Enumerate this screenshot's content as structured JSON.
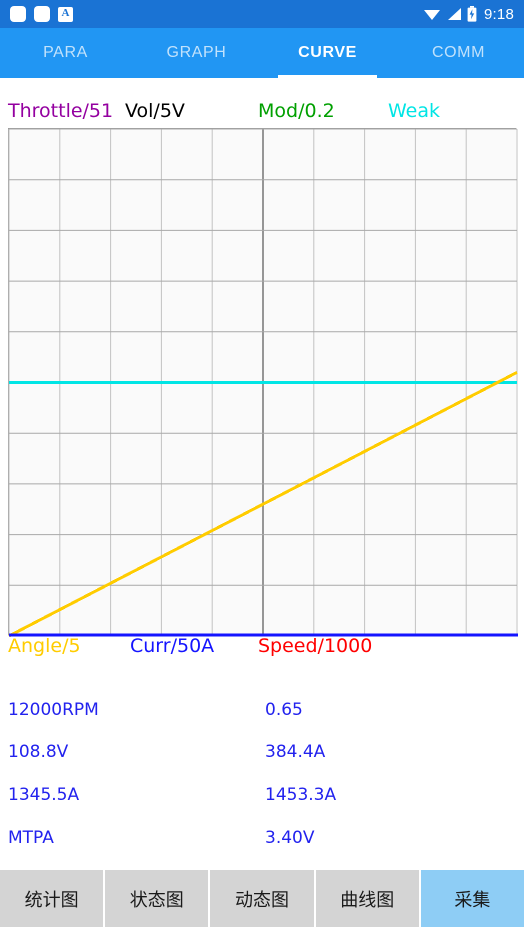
{
  "statusbar": {
    "icons": [
      "square-icon",
      "square-icon",
      "keyboard-ime-icon",
      "wifi-icon",
      "signal-icon",
      "battery-charging-icon"
    ],
    "ime_label": "A",
    "time": "9:18"
  },
  "tabs": [
    {
      "label": "PARA",
      "active": false
    },
    {
      "label": "GRAPH",
      "active": false
    },
    {
      "label": "CURVE",
      "active": true
    },
    {
      "label": "COMM",
      "active": false
    }
  ],
  "chart_data": {
    "type": "line",
    "title": "",
    "xlabel": "",
    "ylabel": "",
    "grid": true,
    "grid_cols": 10,
    "grid_rows": 10,
    "xlim": [
      0,
      10
    ],
    "ylim": [
      0,
      10
    ],
    "top_legend": [
      {
        "label": "Throttle/51",
        "color": "#9400a0"
      },
      {
        "label": "Vol/5V",
        "color": "#000000"
      },
      {
        "label": "Mod/0.2",
        "color": "#00a000"
      },
      {
        "label": "Weak",
        "color": "#00e5e5"
      }
    ],
    "bottom_legend": [
      {
        "label": "Angle/5",
        "color": "#ffcc00"
      },
      {
        "label": "Curr/50A",
        "color": "#1414ff"
      },
      {
        "label": "Speed/1000",
        "color": "#ff0000"
      }
    ],
    "axis_color": "#1414ff",
    "series": [
      {
        "name": "Weak",
        "color": "#00e5e5",
        "x": [
          0,
          10
        ],
        "values": [
          5.0,
          5.0
        ]
      },
      {
        "name": "Angle/5",
        "color": "#ffcc00",
        "x": [
          0,
          10
        ],
        "values": [
          0.0,
          5.2
        ]
      }
    ]
  },
  "readouts": [
    {
      "col1": "12000RPM",
      "col2": "0.65"
    },
    {
      "col1": "108.8V",
      "col2": "384.4A"
    },
    {
      "col1": "1345.5A",
      "col2": "1453.3A"
    },
    {
      "col1": "MTPA",
      "col2": "3.40V"
    }
  ],
  "buttons": [
    {
      "label": "统计图",
      "primary": false
    },
    {
      "label": "状态图",
      "primary": false
    },
    {
      "label": "动态图",
      "primary": false
    },
    {
      "label": "曲线图",
      "primary": false
    },
    {
      "label": "采集",
      "primary": true
    }
  ]
}
